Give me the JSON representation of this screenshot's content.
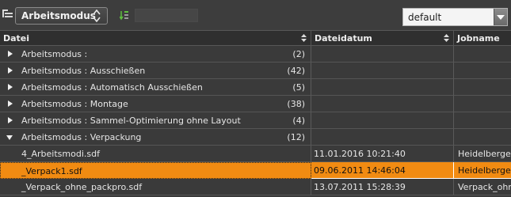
{
  "toolbar": {
    "mode_label": "Arbeitsmodus",
    "search_value": "",
    "preset_value": "default"
  },
  "columns": [
    "Datei",
    "Dateidatum",
    "Jobname"
  ],
  "groups": [
    {
      "label": "Arbeitsmodus :",
      "count": "(2)"
    },
    {
      "label": "Arbeitsmodus : Ausschießen",
      "count": "(42)"
    },
    {
      "label": "Arbeitsmodus : Automatisch Ausschießen",
      "count": "(5)"
    },
    {
      "label": "Arbeitsmodus : Montage",
      "count": "(38)"
    },
    {
      "label": "Arbeitsmodus : Sammel-Optimierung ohne Layout",
      "count": "(4)"
    },
    {
      "label": "Arbeitsmodus : Verpackung",
      "count": "(12)"
    }
  ],
  "files": [
    {
      "name": "4_Arbeitsmodi.sdf",
      "date": "11.01.2016 10:21:40",
      "job": "Heidelberge"
    },
    {
      "name": "_Verpack1.sdf",
      "date": "09.06.2011 14:46:04",
      "job": "Heidelberge"
    },
    {
      "name": "_Verpack_ohne_packpro.sdf",
      "date": "13.07.2011 15:28:39",
      "job": "Verpack_ohne"
    }
  ],
  "colors": {
    "background": "#3a3a3a",
    "header": "#2f2f2f",
    "selection": "#f18b12",
    "filter_icon": "#5fbf3f"
  },
  "icons": [
    "group-by-icon",
    "sort-updown-icon",
    "filter-icon",
    "dropdown-arrow-icon",
    "expand-icon",
    "collapse-icon"
  ]
}
